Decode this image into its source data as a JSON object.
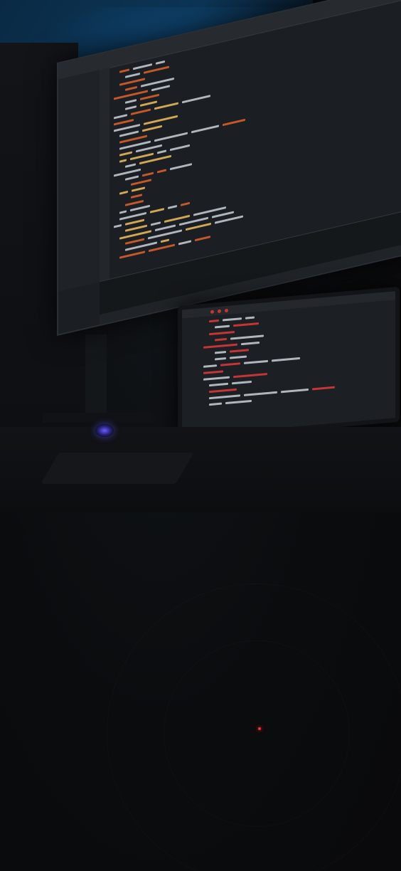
{
  "scene": {
    "description_colors": {
      "backlight": "#0c3556",
      "editor_bg": "#1b1e22",
      "keyword": "#e0642c",
      "function": "#f0c060",
      "plain": "#c9d1d9",
      "laptop_accent": "#e03a3a",
      "led": "#ff2a2a"
    }
  },
  "icons": {
    "mouse_pad_light": "glowing-puck-icon",
    "standby_led": "red-led-icon"
  }
}
